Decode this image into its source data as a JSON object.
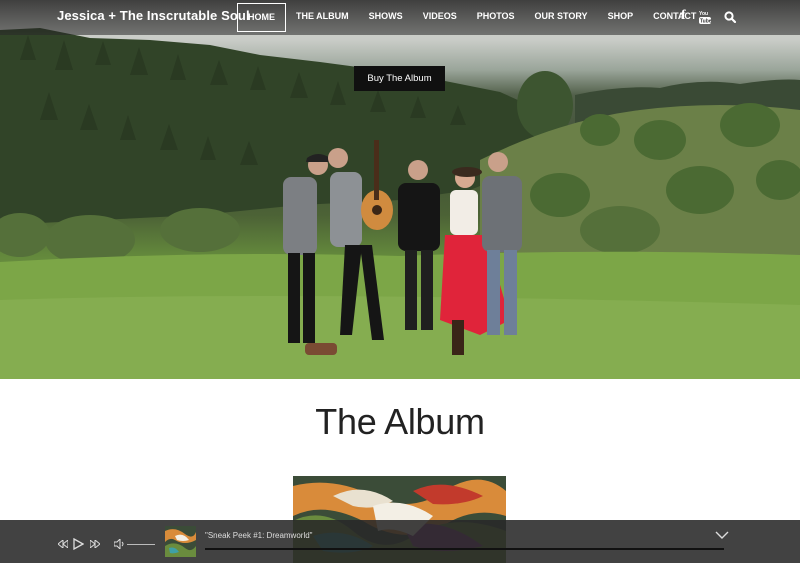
{
  "brand": "Jessica + The Inscrutable Soul",
  "nav": {
    "items": [
      {
        "label": "HOME",
        "active": true
      },
      {
        "label": "THE ALBUM",
        "active": false
      },
      {
        "label": "SHOWS",
        "active": false
      },
      {
        "label": "VIDEOS",
        "active": false
      },
      {
        "label": "PHOTOS",
        "active": false
      },
      {
        "label": "OUR STORY",
        "active": false
      },
      {
        "label": "SHOP",
        "active": false
      },
      {
        "label": "CONTACT",
        "active": false
      }
    ],
    "icons": [
      "facebook-icon",
      "youtube-icon",
      "search-icon"
    ]
  },
  "hero": {
    "cta_label": "Buy The Album"
  },
  "section": {
    "title": "The Album"
  },
  "player": {
    "track_title": "\"Sneak Peek #1: Dreamworld\"",
    "icons": [
      "rewind-icon",
      "play-icon",
      "fast-forward-icon",
      "volume-icon",
      "chevron-down-icon"
    ]
  },
  "colors": {
    "nav_bg": "#1a1a1a",
    "cta_bg": "#101010",
    "skirt_red": "#e0243a",
    "grass": "#78a048"
  }
}
